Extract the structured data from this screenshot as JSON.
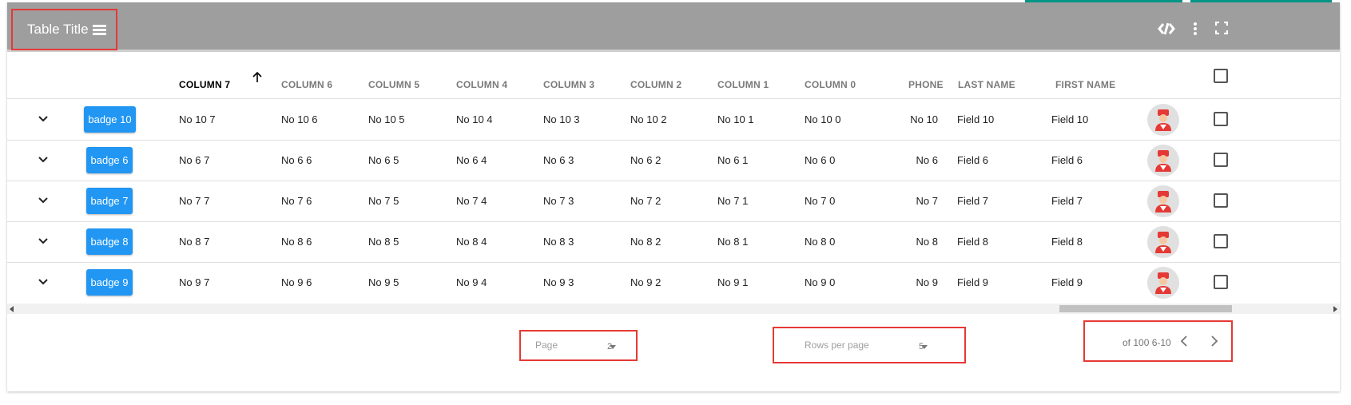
{
  "toolbar": {
    "title": "Table Title",
    "title_icon": "list-icon",
    "code_icon": "code-icon",
    "more_icon": "more-vert-icon",
    "fullscreen_icon": "fullscreen-icon"
  },
  "columns": [
    {
      "label": "COLUMN 7",
      "sorted": true,
      "sort_dir": "asc"
    },
    {
      "label": "COLUMN 6"
    },
    {
      "label": "COLUMN 5"
    },
    {
      "label": "COLUMN 4"
    },
    {
      "label": "COLUMN 3"
    },
    {
      "label": "COLUMN 2"
    },
    {
      "label": "COLUMN 1"
    },
    {
      "label": "COLUMN 0"
    },
    {
      "label": "PHONE"
    },
    {
      "label": "LAST NAME"
    },
    {
      "label": "FIRST NAME"
    }
  ],
  "rows": [
    {
      "badge": "badge 10",
      "c7": "No 10 7",
      "c6": "No 10 6",
      "c5": "No 10 5",
      "c4": "No 10 4",
      "c3": "No 10 3",
      "c2": "No 10 2",
      "c1": "No 10 1",
      "c0": "No 10 0",
      "phone": "No 10",
      "last": "Field 10",
      "first": "Field 10"
    },
    {
      "badge": "badge 6",
      "c7": "No 6 7",
      "c6": "No 6 6",
      "c5": "No 6 5",
      "c4": "No 6 4",
      "c3": "No 6 3",
      "c2": "No 6 2",
      "c1": "No 6 1",
      "c0": "No 6 0",
      "phone": "No 6",
      "last": "Field 6",
      "first": "Field 6"
    },
    {
      "badge": "badge 7",
      "c7": "No 7 7",
      "c6": "No 7 6",
      "c5": "No 7 5",
      "c4": "No 7 4",
      "c3": "No 7 3",
      "c2": "No 7 2",
      "c1": "No 7 1",
      "c0": "No 7 0",
      "phone": "No 7",
      "last": "Field 7",
      "first": "Field 7"
    },
    {
      "badge": "badge 8",
      "c7": "No 8 7",
      "c6": "No 8 6",
      "c5": "No 8 5",
      "c4": "No 8 4",
      "c3": "No 8 3",
      "c2": "No 8 2",
      "c1": "No 8 1",
      "c0": "No 8 0",
      "phone": "No 8",
      "last": "Field 8",
      "first": "Field 8"
    },
    {
      "badge": "badge 9",
      "c7": "No 9 7",
      "c6": "No 9 6",
      "c5": "No 9 5",
      "c4": "No 9 4",
      "c3": "No 9 3",
      "c2": "No 9 2",
      "c1": "No 9 1",
      "c0": "No 9 0",
      "phone": "No 9",
      "last": "Field 9",
      "first": "Field 9"
    }
  ],
  "footer": {
    "page_label": "Page",
    "page_value": "2",
    "rows_per_page_label": "Rows per page",
    "rows_per_page_value": "5",
    "range_text": "of 100 6-10"
  },
  "colors": {
    "toolbar": "#9e9e9e",
    "badge": "#2196f3",
    "highlight": "#e53935",
    "accent": "#009688"
  }
}
